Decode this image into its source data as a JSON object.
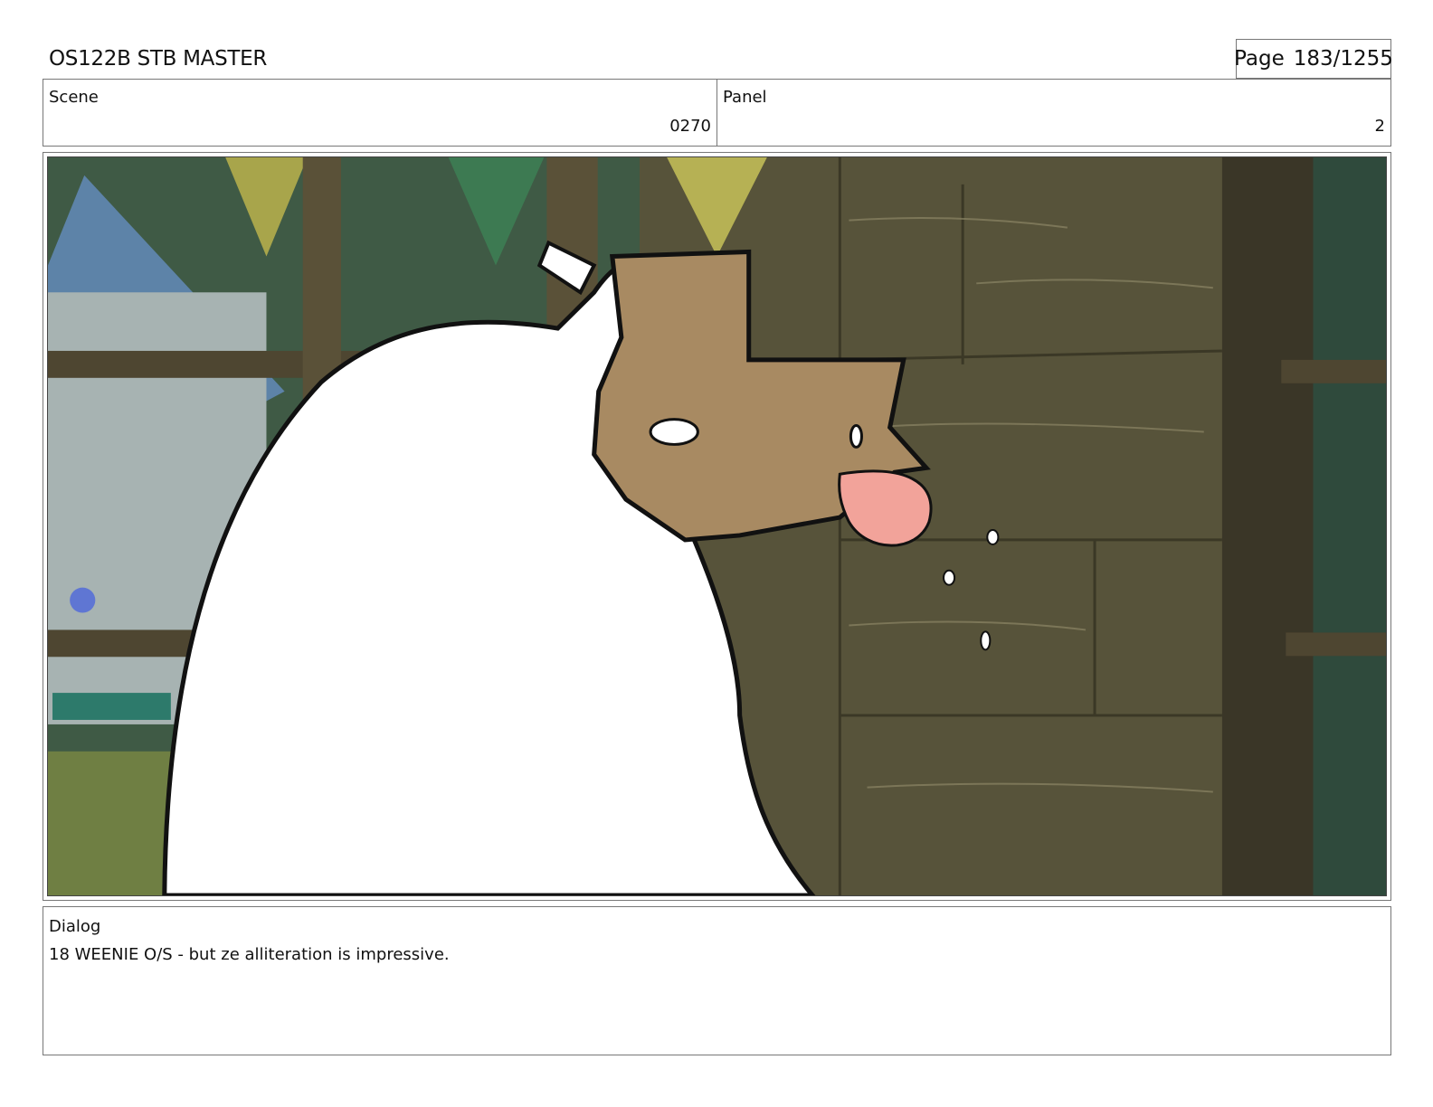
{
  "header": {
    "title": "OS122B STB MASTER",
    "page_label": "Page",
    "page_number": "183/1255"
  },
  "scene": {
    "label": "Scene",
    "value": "0270"
  },
  "panel": {
    "label": "Panel",
    "value": "2"
  },
  "dialog": {
    "label": "Dialog",
    "text": "18 WEENIE O/S - but ze alliteration is impressive."
  },
  "colors": {
    "wall": "#57533a",
    "window_bg": "#3f5a45",
    "fur": "#ffffff",
    "mask": "#a88a62",
    "tongue": "#f2a39a"
  }
}
